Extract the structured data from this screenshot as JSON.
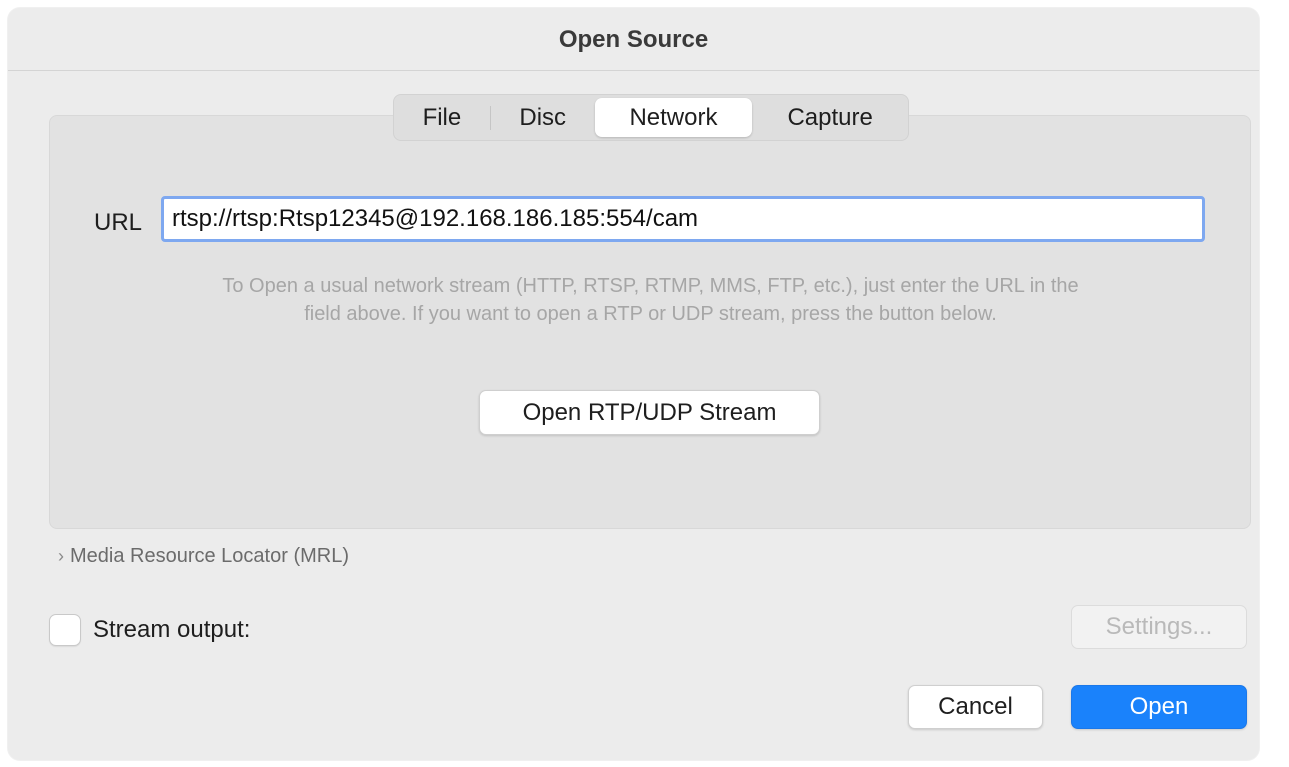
{
  "window": {
    "title": "Open Source"
  },
  "tabs": [
    {
      "label": "File",
      "selected": false
    },
    {
      "label": "Disc",
      "selected": false
    },
    {
      "label": "Network",
      "selected": true
    },
    {
      "label": "Capture",
      "selected": false
    }
  ],
  "network": {
    "url_label": "URL",
    "url_value": "rtsp://rtsp:Rtsp12345@192.168.186.185:554/cam",
    "help_line1": "To Open a usual network stream (HTTP, RTSP, RTMP, MMS, FTP, etc.), just enter the URL in the",
    "help_line2": "field above. If you want to open a RTP or UDP stream, press the button below.",
    "rtp_button": "Open RTP/UDP Stream"
  },
  "mrl": {
    "label": "Media Resource Locator (MRL)",
    "chevron": "›"
  },
  "stream_output": {
    "label": "Stream output:",
    "checked": false,
    "settings_button": "Settings..."
  },
  "footer": {
    "cancel_button": "Cancel",
    "open_button": "Open"
  },
  "colors": {
    "accent": "#1a82fb",
    "focus_ring": "#7ea8f0"
  }
}
